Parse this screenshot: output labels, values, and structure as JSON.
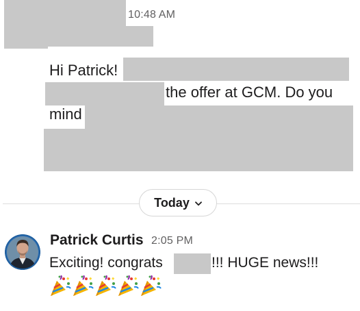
{
  "first_message": {
    "timestamp": "10:48 AM",
    "line1": "Hi Patrick!",
    "line2": "the offer at GCM. Do you",
    "line3": "mind"
  },
  "date_divider": {
    "label": "Today",
    "chevron": "chevron-down-icon"
  },
  "second_message": {
    "author": "Patrick Curtis",
    "timestamp": "2:05 PM",
    "text_before": "Exciting! congrats",
    "text_after": "!!!  HUGE news!!!",
    "emoji": [
      "party-popper-icon",
      "party-popper-icon",
      "party-popper-icon",
      "party-popper-icon",
      "party-popper-icon"
    ]
  },
  "colors": {
    "redaction": "#c8c8c8",
    "text": "#1d1c1d",
    "muted": "#616061",
    "divider": "#dddddd"
  }
}
